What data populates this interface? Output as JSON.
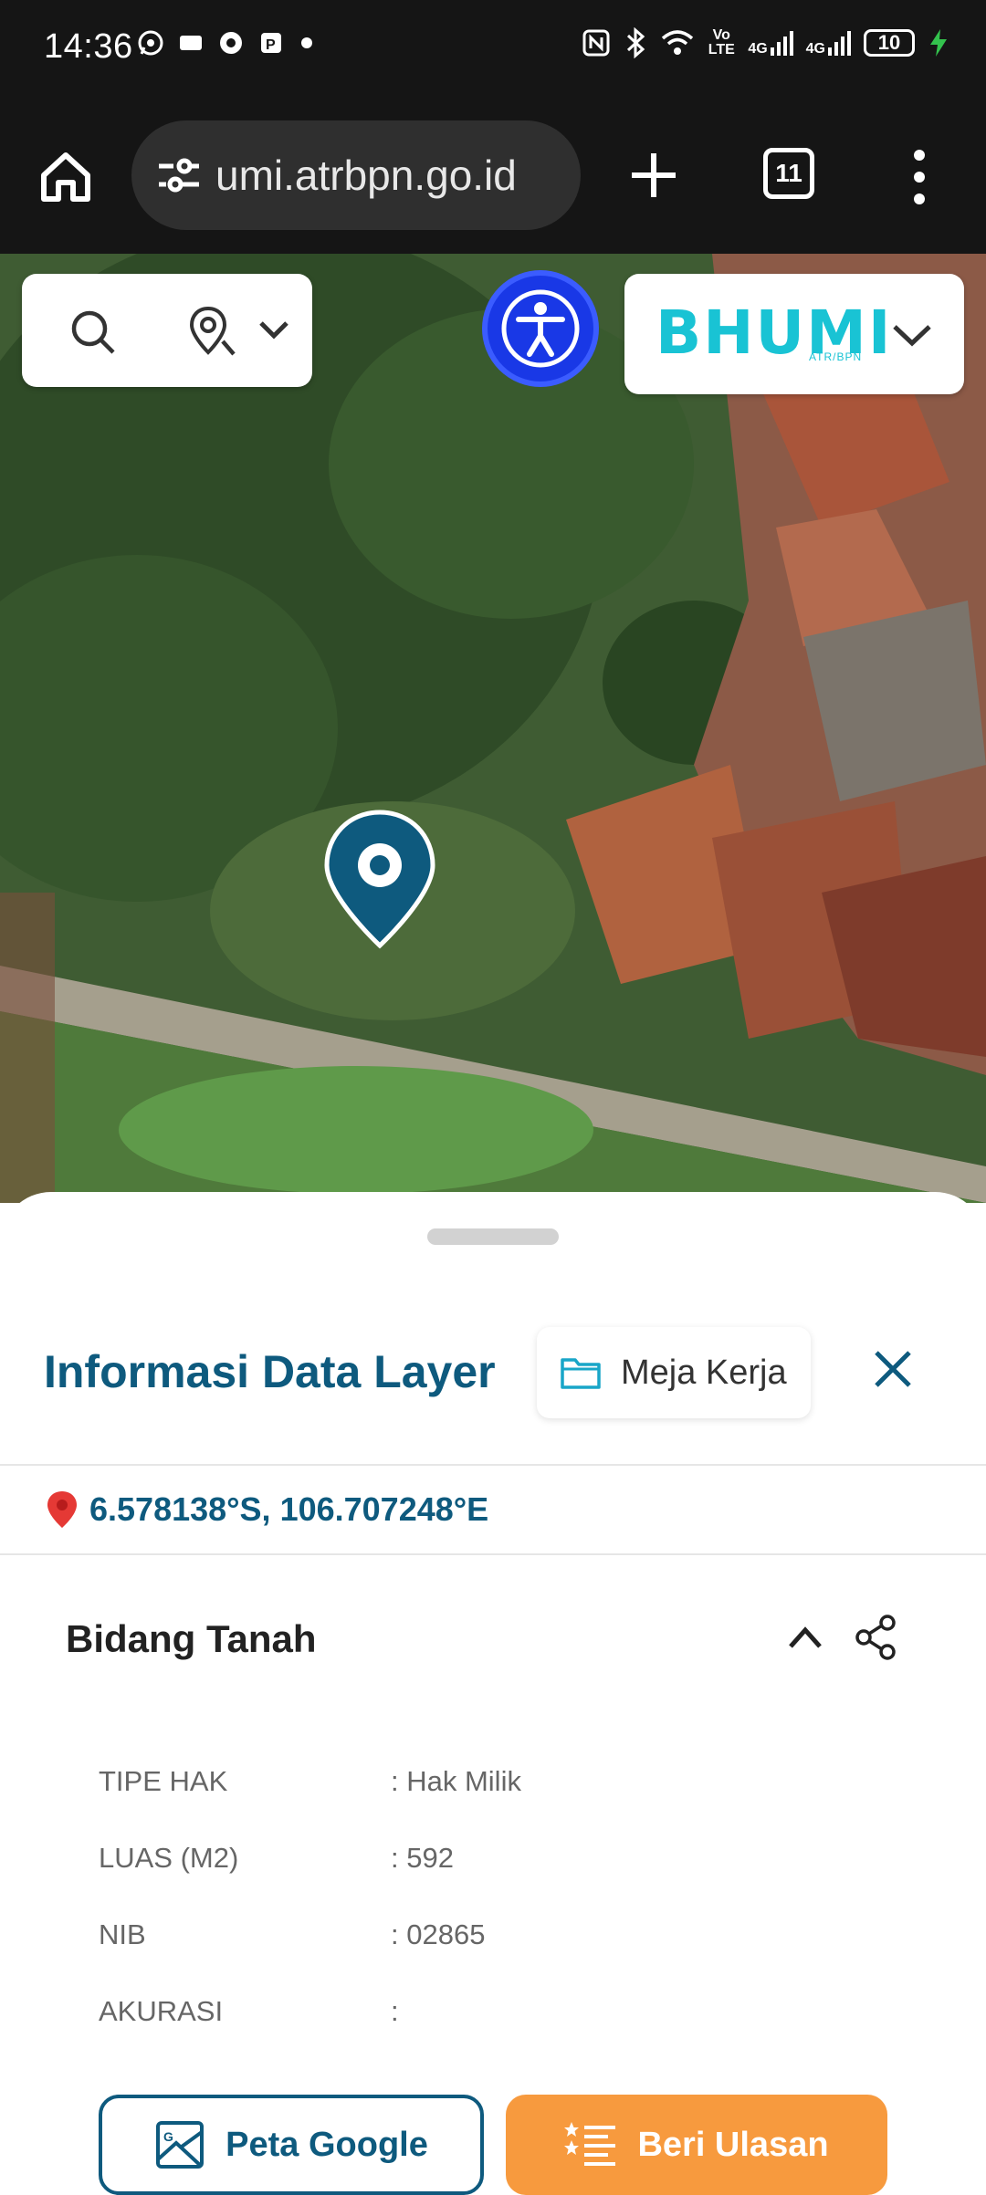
{
  "status_bar": {
    "time": "14:36",
    "network_volte": "Vo LTE",
    "network_1": "4G",
    "network_2": "4G",
    "battery": "10"
  },
  "browser": {
    "url": "umi.atrbpn.go.id",
    "tab_count": "11"
  },
  "map": {
    "brand": "BHUMI",
    "brand_sub": "ATR/BPN"
  },
  "panel": {
    "title": "Informasi Data Layer",
    "workspace_label": "Meja Kerja",
    "coordinates": "6.578138°S, 106.707248°E",
    "section_title": "Bidang Tanah",
    "rows": [
      {
        "label": "TIPE HAK",
        "value": ": Hak Milik"
      },
      {
        "label": "LUAS (M2)",
        "value": ": 592"
      },
      {
        "label": "NIB",
        "value": ": 02865"
      },
      {
        "label": "AKURASI",
        "value": ":"
      }
    ],
    "google_button": "Peta Google",
    "review_button": "Beri Ulasan"
  },
  "colors": {
    "primary": "#0e5a7e",
    "accent_orange": "#f79a3e",
    "brand_cyan": "#19c3d4",
    "access_blue": "#1938e6"
  }
}
